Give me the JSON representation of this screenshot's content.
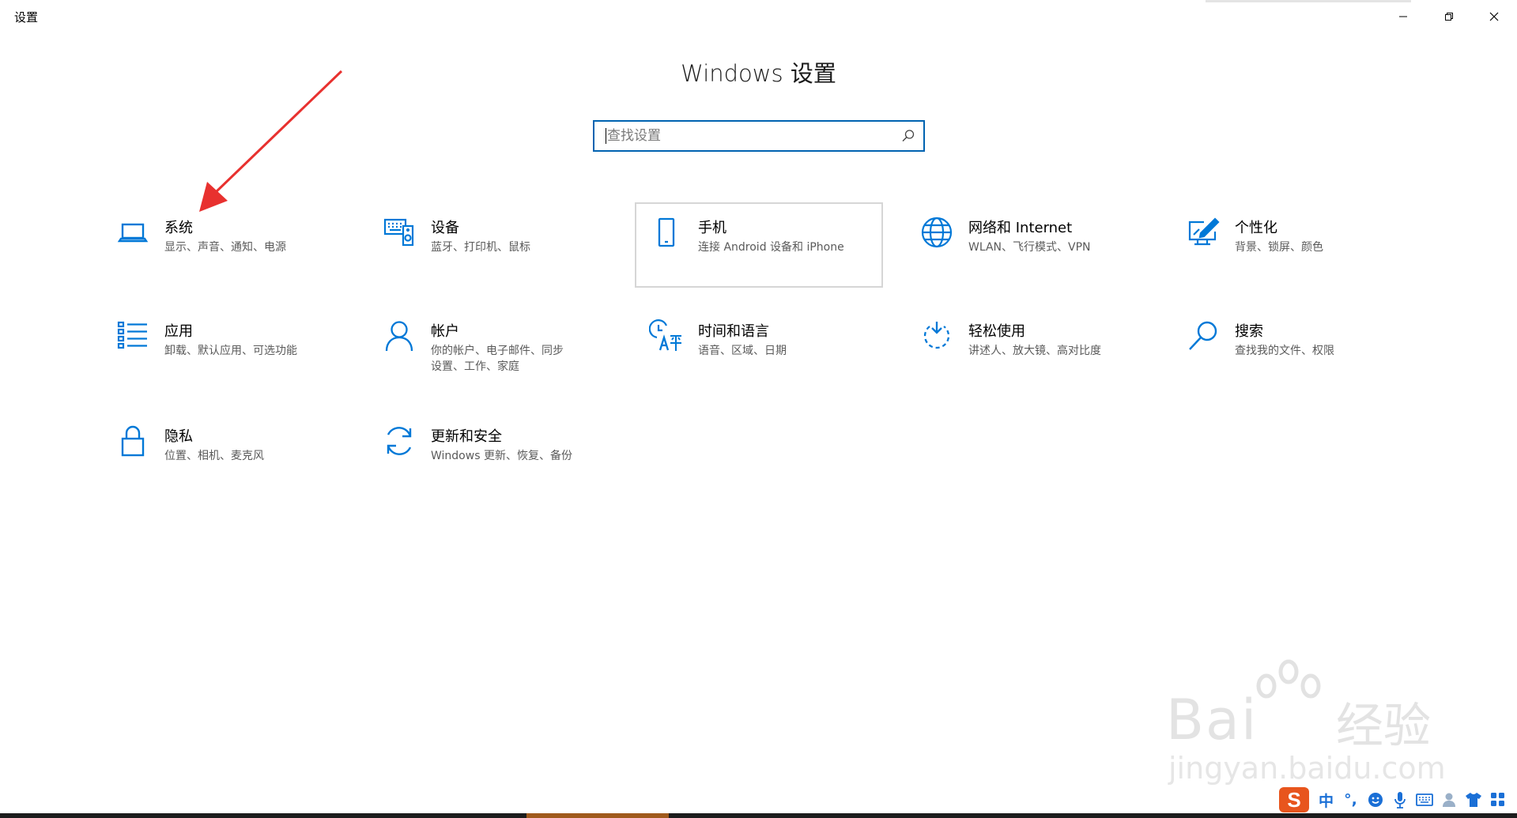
{
  "window": {
    "title": "设置"
  },
  "heading": "Windows 设置",
  "search": {
    "placeholder": "查找设置"
  },
  "tiles": [
    {
      "title": "系统",
      "desc": "显示、声音、通知、电源",
      "icon": "laptop-icon"
    },
    {
      "title": "设备",
      "desc": "蓝牙、打印机、鼠标",
      "icon": "devices-icon"
    },
    {
      "title": "手机",
      "desc": "连接 Android 设备和 iPhone",
      "icon": "phone-icon"
    },
    {
      "title": "网络和 Internet",
      "desc": "WLAN、飞行模式、VPN",
      "icon": "globe-icon"
    },
    {
      "title": "个性化",
      "desc": "背景、锁屏、颜色",
      "icon": "personalization-icon"
    },
    {
      "title": "应用",
      "desc": "卸载、默认应用、可选功能",
      "icon": "apps-list-icon"
    },
    {
      "title": "帐户",
      "desc": "你的帐户、电子邮件、同步设置、工作、家庭",
      "icon": "person-icon"
    },
    {
      "title": "时间和语言",
      "desc": "语音、区域、日期",
      "icon": "time-language-icon"
    },
    {
      "title": "轻松使用",
      "desc": "讲述人、放大镜、高对比度",
      "icon": "ease-of-access-icon"
    },
    {
      "title": "搜索",
      "desc": "查找我的文件、权限",
      "icon": "search-icon"
    },
    {
      "title": "隐私",
      "desc": "位置、相机、麦克风",
      "icon": "lock-icon"
    },
    {
      "title": "更新和安全",
      "desc": "Windows 更新、恢复、备份",
      "icon": "sync-icon"
    }
  ],
  "watermark": {
    "brand": "Bai",
    "brand_cn": "经验",
    "url": "jingyan.baidu.com"
  },
  "ime": {
    "logo": "S",
    "mode": "中",
    "punct": "°,"
  },
  "colors": {
    "accent": "#0063b1",
    "icon_blue": "#0078d7",
    "annotation_arrow": "#e8312f"
  }
}
